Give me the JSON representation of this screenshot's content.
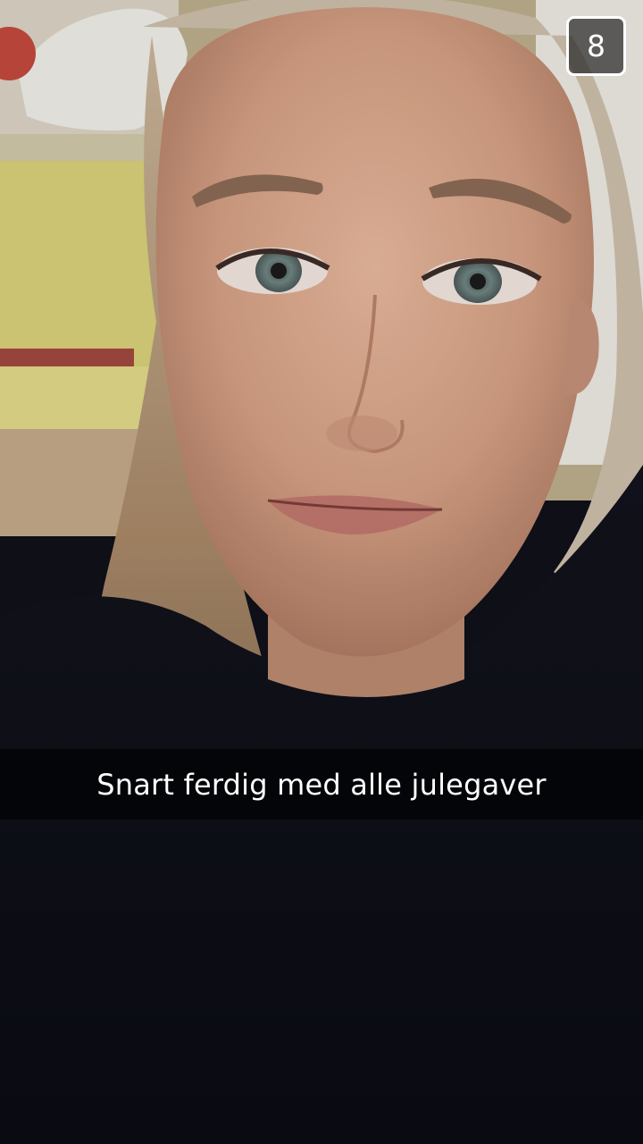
{
  "snap": {
    "timer_seconds": "8",
    "caption": "Snart ferdig med alle julegaver"
  },
  "photo": {
    "subject": "selfie",
    "background_color": "#0e0f18"
  },
  "icons": {
    "timer": "timer-badge-icon"
  }
}
